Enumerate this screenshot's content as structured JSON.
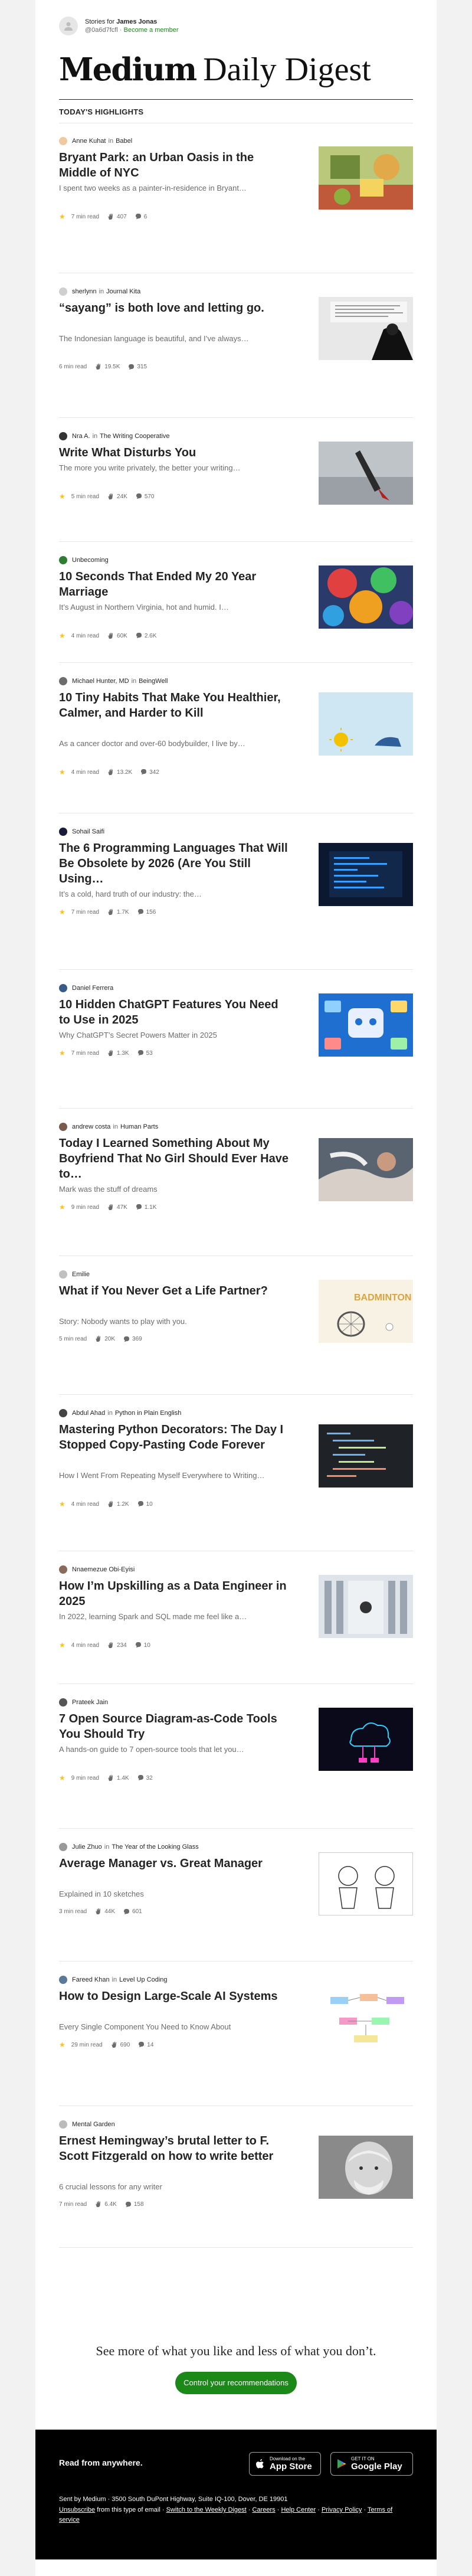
{
  "header": {
    "stories_for_prefix": "Stories for",
    "user_name": "James Jonas",
    "handle": "@0a6d7fcfl",
    "separator": "·",
    "become_member": "Become a member"
  },
  "masthead": {
    "brand": "Medium",
    "digest": "Daily Digest"
  },
  "highlights_label": "TODAY'S HIGHLIGHTS",
  "colors": {
    "accent_green": "#1a8917",
    "star_gold": "#ffc017",
    "text": "#242424",
    "muted": "#6b6b6b"
  },
  "articles": [
    {
      "author": "Anne Kuhat",
      "in": "in",
      "publication": "Babel",
      "title": "Bryant Park: an Urban Oasis in the Middle of NYC",
      "subtitle": "I spent two weeks as a painter-in-residence in Bryant…",
      "member": true,
      "read": "7 min read",
      "claps": "407",
      "responses": "6"
    },
    {
      "author": "sherlynn",
      "in": "in",
      "publication": "Journal Kita",
      "title": "“sayang” is both love and letting go.",
      "subtitle": "The Indonesian language is beautiful, and I’ve always…",
      "member": false,
      "read": "6 min read",
      "claps": "19.5K",
      "responses": "315"
    },
    {
      "author": "Nra A.",
      "in": "in",
      "publication": "The Writing Cooperative",
      "title": "Write What Disturbs You",
      "subtitle": "The more you write privately, the better your writing…",
      "member": true,
      "read": "5 min read",
      "claps": "24K",
      "responses": "570"
    },
    {
      "author": "Unbecoming",
      "in": "",
      "publication": "",
      "title": "10 Seconds That Ended My 20 Year Marriage",
      "subtitle": "It’s August in Northern Virginia, hot and humid. I…",
      "member": true,
      "read": "4 min read",
      "claps": "60K",
      "responses": "2.6K"
    },
    {
      "author": "Michael Hunter, MD",
      "in": "in",
      "publication": "BeingWell",
      "title": "10 Tiny Habits That Make You Healthier, Calmer, and Harder to Kill",
      "subtitle": "As a cancer doctor and over-60 bodybuilder, I live by…",
      "member": true,
      "read": "4 min read",
      "claps": "13.2K",
      "responses": "342"
    },
    {
      "author": "Sohail Saifi",
      "in": "",
      "publication": "",
      "title": "The 6 Programming Languages That Will Be Obsolete by 2026 (Are You Still Using…",
      "subtitle": "It’s a cold, hard truth of our industry: the…",
      "member": true,
      "read": "7 min read",
      "claps": "1.7K",
      "responses": "156"
    },
    {
      "author": "Daniel Ferrera",
      "in": "",
      "publication": "",
      "title": "10 Hidden ChatGPT Features You Need to Use in 2025",
      "subtitle": "Why ChatGPT’s Secret Powers Matter in 2025",
      "member": true,
      "read": "7 min read",
      "claps": "1.3K",
      "responses": "53"
    },
    {
      "author": "andrew costa",
      "in": "in",
      "publication": "Human Parts",
      "title": "Today I Learned Something About My Boyfriend That No Girl Should Ever Have to…",
      "subtitle": "Mark was the stuff of dreams",
      "member": true,
      "read": "9 min read",
      "claps": "47K",
      "responses": "1.1K"
    },
    {
      "author": "Emilie",
      "in": "",
      "publication": "",
      "title": "What if You Never Get a Life Partner?",
      "subtitle": "Story: Nobody wants to play with you.",
      "member": false,
      "read": "5 min read",
      "claps": "20K",
      "responses": "369"
    },
    {
      "author": "Abdul Ahad",
      "in": "in",
      "publication": "Python in Plain English",
      "title": "Mastering Python Decorators: The Day I Stopped Copy-Pasting Code Forever",
      "subtitle": "How I Went From Repeating Myself Everywhere to Writing…",
      "member": true,
      "read": "4 min read",
      "claps": "1.2K",
      "responses": "10"
    },
    {
      "author": "Nnaemezue Obi-Eyisi",
      "in": "",
      "publication": "",
      "title": "How I’m Upskilling as a Data Engineer in 2025",
      "subtitle": "In 2022, learning Spark and SQL made me feel like a…",
      "member": true,
      "read": "4 min read",
      "claps": "234",
      "responses": "10"
    },
    {
      "author": "Prateek Jain",
      "in": "",
      "publication": "",
      "title": "7 Open Source Diagram-as-Code Tools You Should Try",
      "subtitle": "A hands-on guide to 7 open-source tools that let you…",
      "member": true,
      "read": "9 min read",
      "claps": "1.4K",
      "responses": "32"
    },
    {
      "author": "Julie Zhuo",
      "in": "in",
      "publication": "The Year of the Looking Glass",
      "title": "Average Manager vs. Great Manager",
      "subtitle": "Explained in 10 sketches",
      "member": false,
      "read": "3 min read",
      "claps": "44K",
      "responses": "601"
    },
    {
      "author": "Fareed Khan",
      "in": "in",
      "publication": "Level Up Coding",
      "title": "How to Design Large-Scale AI Systems",
      "subtitle": "Every Single Component You Need to Know About",
      "member": true,
      "read": "29 min read",
      "claps": "690",
      "responses": "14"
    },
    {
      "author": "Mental Garden",
      "in": "",
      "publication": "",
      "title": "Ernest Hemingway’s brutal letter to F. Scott Fitzgerald on how to write better",
      "subtitle": "6 crucial lessons for any writer",
      "member": false,
      "read": "7 min read",
      "claps": "6.4K",
      "responses": "158"
    }
  ],
  "footer_cta": {
    "text": "See more of what you like and less of what you don’t.",
    "button": "Control your recommendations"
  },
  "footer": {
    "read_from_anywhere": "Read from anywhere.",
    "appstore_small": "Download on the",
    "appstore_big": "App Store",
    "googleplay_small": "GET IT ON",
    "googleplay_big": "Google Play",
    "address": "Sent by Medium · 3500 South DuPont Highway, Suite IQ-100, Dover, DE 19901",
    "unsubscribe": "Unsubscribe",
    "unsubscribe_rest": "from this type of email ·",
    "switch_weekly": "Switch to the Weekly Digest",
    "careers": "Careers",
    "help_center": "Help Center",
    "privacy_policy": "Privacy Policy",
    "terms": "Terms of service",
    "dot": "·"
  }
}
